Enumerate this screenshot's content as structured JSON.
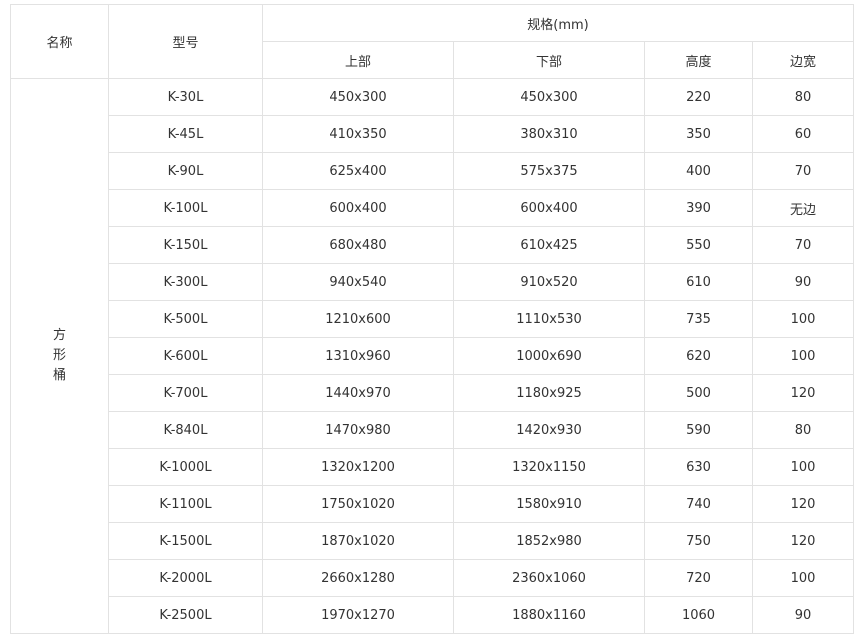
{
  "header": {
    "name": "名称",
    "model": "型号",
    "spec": "规格(mm)",
    "top": "上部",
    "bottom": "下部",
    "height": "高度",
    "edge": "边宽"
  },
  "category": {
    "line1": "方",
    "line2": "形",
    "line3": "桶"
  },
  "rows": [
    {
      "model": "K-30L",
      "top": "450x300",
      "bottom": "450x300",
      "height": "220",
      "edge": "80"
    },
    {
      "model": "K-45L",
      "top": "410x350",
      "bottom": "380x310",
      "height": "350",
      "edge": "60"
    },
    {
      "model": "K-90L",
      "top": "625x400",
      "bottom": "575x375",
      "height": "400",
      "edge": "70"
    },
    {
      "model": "K-100L",
      "top": "600x400",
      "bottom": "600x400",
      "height": "390",
      "edge": "无边"
    },
    {
      "model": "K-150L",
      "top": "680x480",
      "bottom": "610x425",
      "height": "550",
      "edge": "70"
    },
    {
      "model": "K-300L",
      "top": "940x540",
      "bottom": "910x520",
      "height": "610",
      "edge": "90"
    },
    {
      "model": "K-500L",
      "top": "1210x600",
      "bottom": "1110x530",
      "height": "735",
      "edge": "100"
    },
    {
      "model": "K-600L",
      "top": "1310x960",
      "bottom": "1000x690",
      "height": "620",
      "edge": "100"
    },
    {
      "model": "K-700L",
      "top": "1440x970",
      "bottom": "1180x925",
      "height": "500",
      "edge": "120"
    },
    {
      "model": "K-840L",
      "top": "1470x980",
      "bottom": "1420x930",
      "height": "590",
      "edge": "80"
    },
    {
      "model": "K-1000L",
      "top": "1320x1200",
      "bottom": "1320x1150",
      "height": "630",
      "edge": "100"
    },
    {
      "model": "K-1100L",
      "top": "1750x1020",
      "bottom": "1580x910",
      "height": "740",
      "edge": "120"
    },
    {
      "model": "K-1500L",
      "top": "1870x1020",
      "bottom": "1852x980",
      "height": "750",
      "edge": "120"
    },
    {
      "model": "K-2000L",
      "top": "2660x1280",
      "bottom": "2360x1060",
      "height": "720",
      "edge": "100"
    },
    {
      "model": "K-2500L",
      "top": "1970x1270",
      "bottom": "1880x1160",
      "height": "1060",
      "edge": "90"
    }
  ]
}
